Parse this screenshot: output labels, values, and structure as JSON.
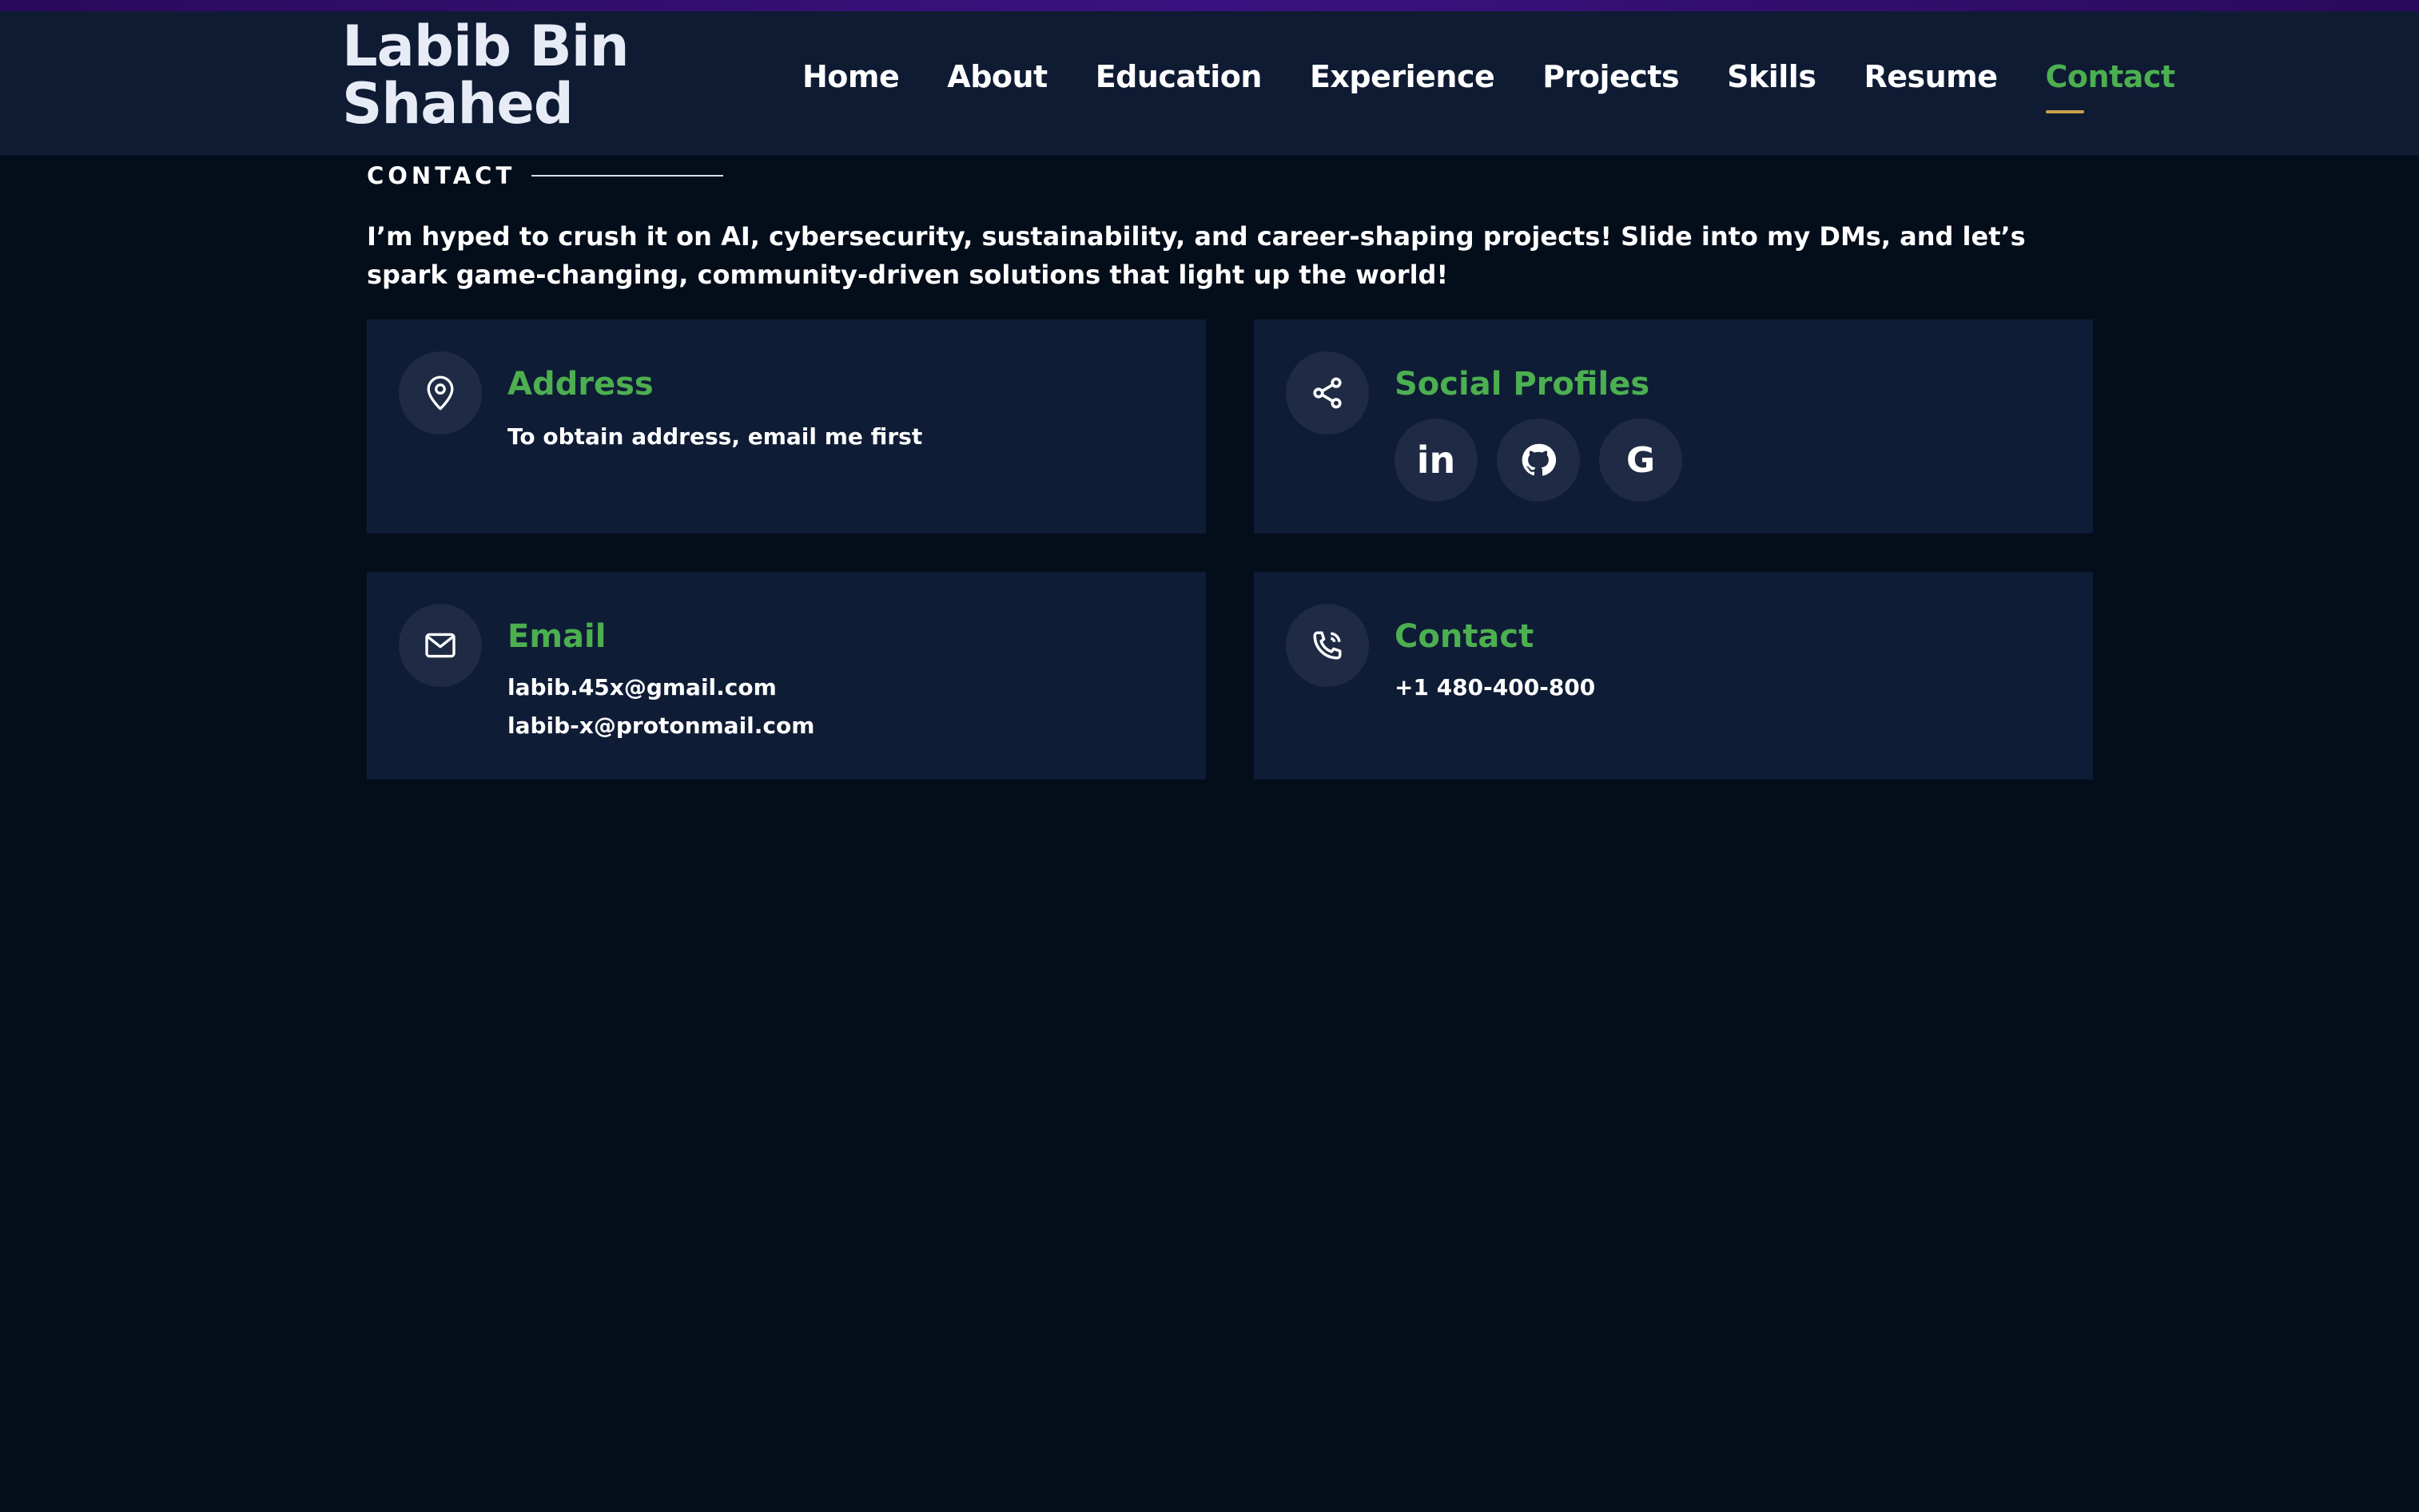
{
  "header": {
    "brand": "Labib Bin Shahed",
    "nav": [
      {
        "label": "Home"
      },
      {
        "label": "About"
      },
      {
        "label": "Education"
      },
      {
        "label": "Experience"
      },
      {
        "label": "Projects"
      },
      {
        "label": "Skills"
      },
      {
        "label": "Resume"
      },
      {
        "label": "Contact",
        "active": true
      }
    ]
  },
  "contact": {
    "section_label": "CONTACT",
    "intro": "I’m hyped to crush it on AI, cybersecurity, sustainability, and career-shaping projects! Slide into my DMs, and let’s spark game-changing, community-driven solutions that light up the world!",
    "address": {
      "icon": "map-pin-icon",
      "title": "Address",
      "text": "To obtain address, email me first"
    },
    "social": {
      "icon": "share-icon",
      "title": "Social Profiles",
      "profiles": [
        {
          "icon": "linkedin-icon",
          "glyph": "in"
        },
        {
          "icon": "github-icon"
        },
        {
          "icon": "google-icon",
          "glyph": "G"
        }
      ]
    },
    "email": {
      "icon": "mail-icon",
      "title": "Email",
      "addresses": [
        "labib.45x@gmail.com",
        "labib-x@protonmail.com"
      ]
    },
    "phone": {
      "icon": "phone-icon",
      "title": "Contact",
      "number": "+1 480-400-800"
    }
  },
  "colors": {
    "accent": "#4caf50",
    "underline": "#c8a04a",
    "card_bg": "#0f1c36",
    "page_bg": "#040d1a",
    "header_bg": "#0f1b33"
  }
}
